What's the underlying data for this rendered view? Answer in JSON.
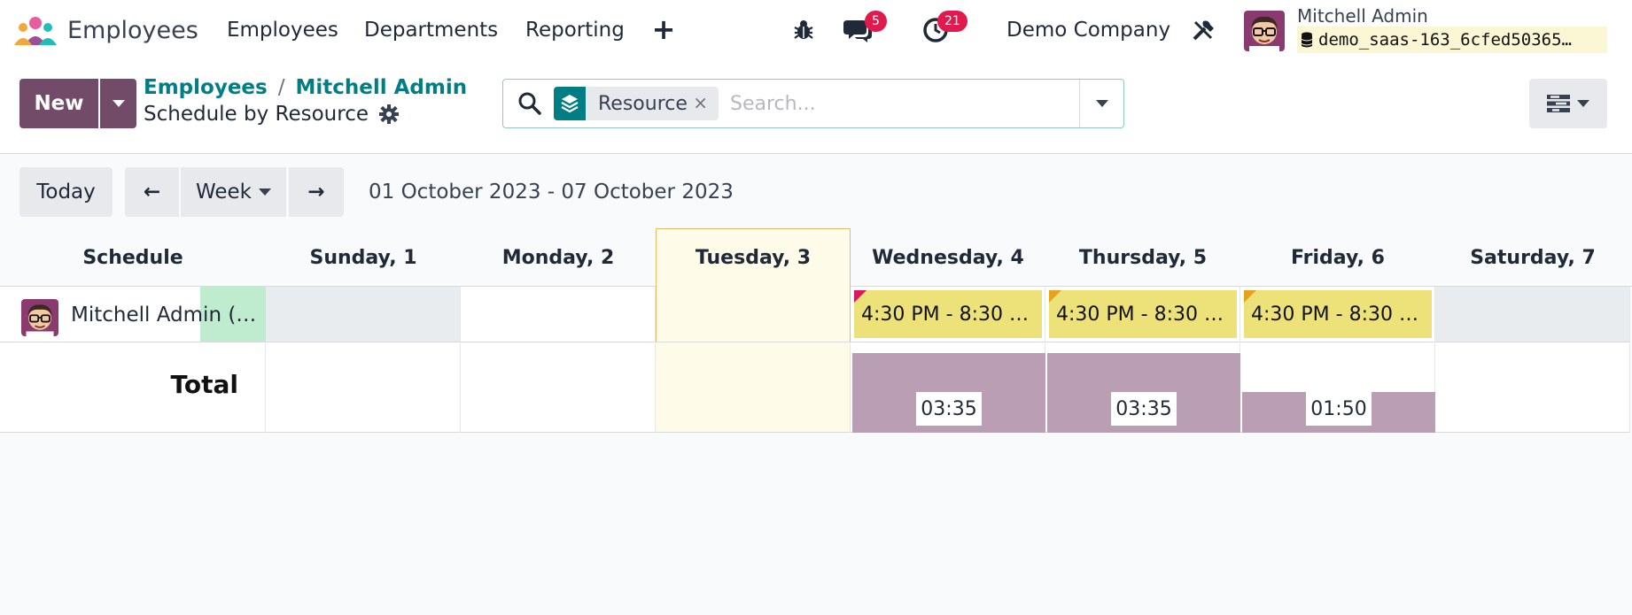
{
  "navbar": {
    "app_name": "Employees",
    "menu": [
      "Employees",
      "Departments",
      "Reporting"
    ],
    "plus_label": "+",
    "messages_count": "5",
    "activities_count": "21",
    "company": "Demo Company",
    "user_name": "Mitchell Admin",
    "db_name": "demo_saas-163_6cfed50365…"
  },
  "control": {
    "new_label": "New",
    "breadcrumb": [
      "Employees",
      "Mitchell Admin"
    ],
    "breadcrumb_sep": "/",
    "view_title": "Schedule by Resource",
    "facet_label": "Resource",
    "facet_remove": "×",
    "search_placeholder": "Search..."
  },
  "toolbar": {
    "today_label": "Today",
    "prev_label": "←",
    "scale_label": "Week",
    "next_label": "→",
    "date_range": "01 October 2023 - 07 October 2023"
  },
  "gantt": {
    "row_header_title": "Schedule",
    "days": [
      "Sunday, 1",
      "Monday, 2",
      "Tuesday, 3",
      "Wednesday, 4",
      "Thursday, 5",
      "Friday, 6",
      "Saturday, 7"
    ],
    "today_index": 2,
    "resource_name": "Mitchell Admin (…",
    "shifts": [
      {
        "day_index": 3,
        "label": "4:30 PM - 8:30 …",
        "corner_color": "#d9195c"
      },
      {
        "day_index": 4,
        "label": "4:30 PM - 8:30 …",
        "corner_color": "#e8a11c"
      },
      {
        "day_index": 5,
        "label": "4:30 PM - 8:30 …",
        "corner_color": "#e8a11c"
      }
    ],
    "total_label": "Total",
    "totals": [
      {
        "day_index": 3,
        "label": "03:35",
        "ratio": 1.0
      },
      {
        "day_index": 4,
        "label": "03:35",
        "ratio": 1.0
      },
      {
        "day_index": 5,
        "label": "01:50",
        "ratio": 0.51
      }
    ]
  },
  "colors": {
    "brand": "#714b67",
    "teal": "#017e84",
    "shift_fill": "#ede179",
    "total_bar": "#b99eb4",
    "today_bg": "#fefce8",
    "badge": "#e01a4f"
  }
}
